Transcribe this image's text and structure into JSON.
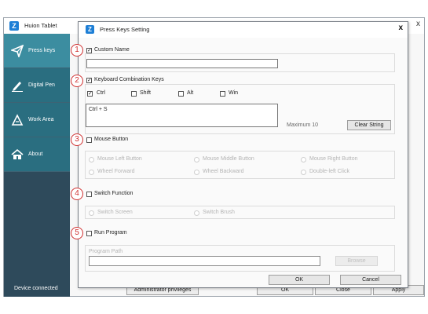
{
  "main_window": {
    "title": "Huion Tablet",
    "close_glyph": "x",
    "sidebar": [
      {
        "label": "Press keys",
        "icon": "paper-plane-icon",
        "active": true
      },
      {
        "label": "Digital Pen",
        "icon": "pen-icon",
        "active": false
      },
      {
        "label": "Work Area",
        "icon": "work-area-icon",
        "active": false
      },
      {
        "label": "About",
        "icon": "home-icon",
        "active": false
      }
    ],
    "status": "Device connected",
    "bottom_buttons": {
      "admin": "Administrator privileges",
      "ok": "OK",
      "close": "Close",
      "apply": "Apply"
    }
  },
  "dialog": {
    "title": "Press Keys Setting",
    "close_glyph": "x",
    "sections": {
      "custom_name": {
        "number": "1",
        "label": "Custom Name",
        "checked": true,
        "value": ""
      },
      "keyboard": {
        "number": "2",
        "label": "Keyboard Combination Keys",
        "checked": true,
        "modifiers": {
          "ctrl": "Ctrl",
          "shift": "Shift",
          "alt": "Alt",
          "win": "Win"
        },
        "modifier_states": {
          "ctrl": true,
          "shift": false,
          "alt": false,
          "win": false
        },
        "value": "Ctrl + S",
        "max_label": "Maximum 10",
        "clear_button": "Clear String"
      },
      "mouse": {
        "number": "3",
        "label": "Mouse Button",
        "checked": false,
        "options": {
          "left": "Mouse Left Button",
          "middle": "Mouse Middle Button",
          "right": "Mouse Right Button",
          "wheel_forward": "Wheel Forward",
          "wheel_backward": "Wheel Backward",
          "double_left": "Double-left Click"
        }
      },
      "switch": {
        "number": "4",
        "label": "Switch Function",
        "checked": false,
        "options": {
          "screen": "Switch Screen",
          "brush": "Switch Brush"
        }
      },
      "program": {
        "number": "5",
        "label": "Run Program",
        "checked": false,
        "path_label": "Program Path",
        "path_value": "",
        "browse_button": "Browse"
      }
    },
    "buttons": {
      "ok": "OK",
      "cancel": "Cancel"
    }
  },
  "colors": {
    "sidebar_bg": "#2e4a5b",
    "sidebar_item": "#2a6e80",
    "sidebar_active": "#3c8da0",
    "annotation_red": "#d03030",
    "logo_blue": "#1e7fd6"
  }
}
